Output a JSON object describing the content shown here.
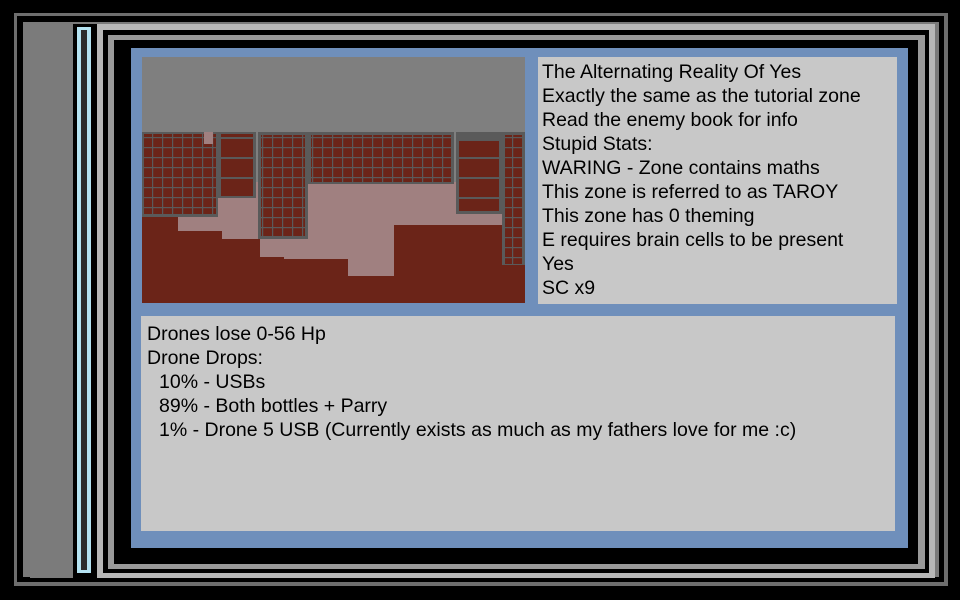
{
  "zone_info": {
    "lines": [
      "The Alternating Reality Of Yes",
      "Exactly the same as the tutorial zone",
      "Read the enemy book for info",
      "Stupid Stats:",
      "WARING - Zone contains maths",
      "This zone is referred to as TAROY",
      "This zone has 0 theming",
      "E requires brain cells to be present",
      "Yes",
      "SC x9"
    ]
  },
  "drone_info": {
    "hp_line": "Drones lose 0-56 Hp",
    "drops_header": "Drone Drops:",
    "drops": [
      "10% - USBs",
      "89% - Both bottles + Parry",
      "1% - Drone 5 USB (Currently exists as much as my fathers love for me :c)"
    ]
  },
  "colors": {
    "panel_blue": "#6f8fbb",
    "panel_gray": "#c8c8c8",
    "sidebar_accent": "#b5e3f2",
    "zone_floor": "#6b2418",
    "zone_path": "#a08080",
    "zone_sky": "#7f7f7f"
  }
}
